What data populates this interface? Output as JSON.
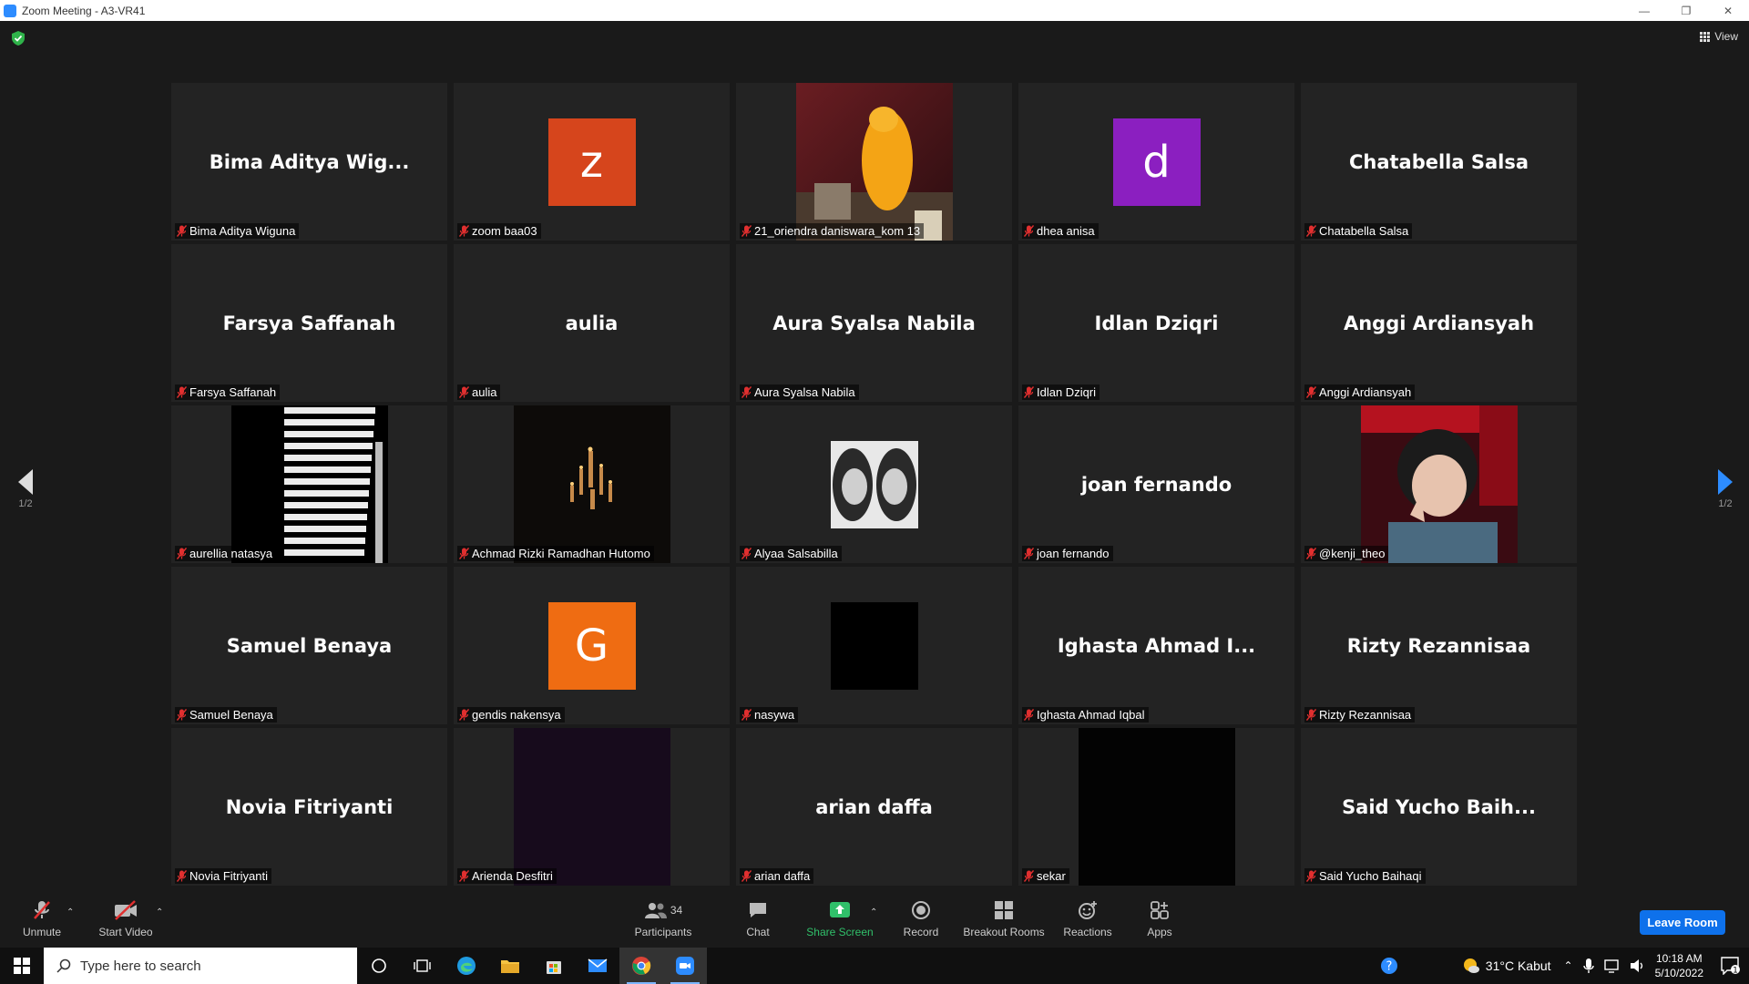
{
  "window": {
    "title": "Zoom Meeting - A3-VR41"
  },
  "header": {
    "view_label": "View"
  },
  "tiles": [
    {
      "big": "Bima Aditya Wig...",
      "label": "Bima Aditya Wiguna"
    },
    {
      "avatar": "z",
      "color": "#d6451c",
      "label": "zoom baa03"
    },
    {
      "video": "yellow-figure",
      "label": "21_oriendra daniswara_kom 13"
    },
    {
      "avatar": "d",
      "color": "#8b1fc0",
      "label": "dhea anisa"
    },
    {
      "big": "Chatabella Salsa",
      "label": "Chatabella Salsa"
    },
    {
      "big": "Farsya Saffanah",
      "label": "Farsya Saffanah"
    },
    {
      "big": "aulia",
      "label": "aulia"
    },
    {
      "big": "Aura Syalsa Nabila",
      "label": "Aura Syalsa Nabila"
    },
    {
      "big": "Idlan Dziqri",
      "label": "Idlan Dziqri"
    },
    {
      "big": "Anggi Ardiansyah",
      "label": "Anggi Ardiansyah"
    },
    {
      "video": "stripes",
      "label": "aurellia natasya"
    },
    {
      "video": "candles",
      "label": "Achmad Rizki Ramadhan Hutomo"
    },
    {
      "video": "two-faces",
      "label": "Alyaa Salsabilla"
    },
    {
      "big": "joan fernando",
      "label": "joan fernando"
    },
    {
      "video": "portrait-red",
      "label": "@kenji_theo"
    },
    {
      "big": "Samuel Benaya",
      "label": "Samuel Benaya"
    },
    {
      "avatar": "G",
      "color": "#ef6c12",
      "label": "gendis nakensya"
    },
    {
      "video": "black-square",
      "label": "nasywa"
    },
    {
      "big": "Ighasta Ahmad I...",
      "label": "Ighasta Ahmad Iqbal"
    },
    {
      "big": "Rizty Rezannisaa",
      "label": "Rizty Rezannisaa"
    },
    {
      "big": "Novia Fitriyanti",
      "label": "Novia Fitriyanti"
    },
    {
      "video": "dark-purple",
      "label": "Arienda Desfitri"
    },
    {
      "big": "arian daffa",
      "label": "arian daffa"
    },
    {
      "video": "black",
      "label": "sekar"
    },
    {
      "big": "Said Yucho Baih...",
      "label": "Said Yucho Baihaqi"
    }
  ],
  "pager": {
    "left": "1/2",
    "right": "1/2"
  },
  "toolbar": {
    "unmute": "Unmute",
    "start_video": "Start Video",
    "participants": "Participants",
    "participants_count": "34",
    "chat": "Chat",
    "share_screen": "Share Screen",
    "record": "Record",
    "breakout": "Breakout Rooms",
    "reactions": "Reactions",
    "apps": "Apps",
    "leave": "Leave Room"
  },
  "taskbar": {
    "search_placeholder": "Type here to search",
    "weather": "31°C  Kabut",
    "time": "10:18 AM",
    "date": "5/10/2022",
    "notif_count": "1"
  },
  "colors": {
    "accent": "#0e71eb",
    "share_green": "#30c06a",
    "mute_red": "#e02f2f"
  }
}
